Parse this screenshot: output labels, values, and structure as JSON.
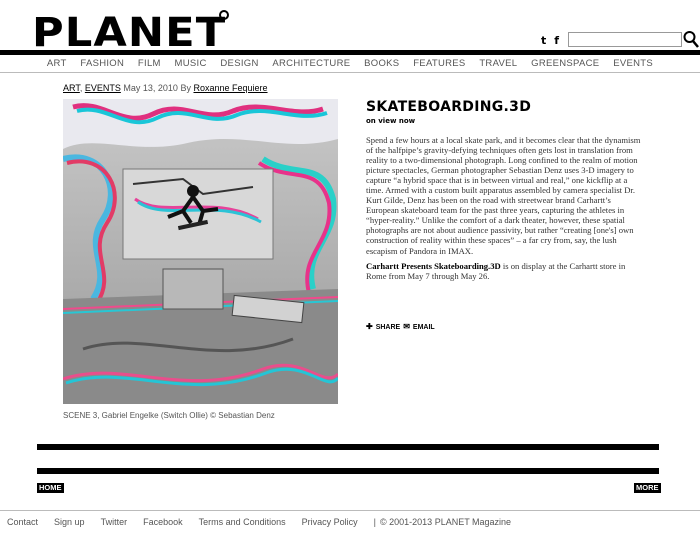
{
  "header": {
    "logo": "PLANET",
    "social": [
      "t",
      "f"
    ],
    "search": {
      "value": "",
      "placeholder": ""
    }
  },
  "nav": [
    "ART",
    "FASHION",
    "FILM",
    "MUSIC",
    "DESIGN",
    "ARCHITECTURE",
    "BOOKS",
    "FEATURES",
    "TRAVEL",
    "GREENSPACE",
    "EVENTS"
  ],
  "article": {
    "categories": [
      "ART",
      "EVENTS"
    ],
    "date": "May 13, 2010",
    "by": "By",
    "author": "Roxanne Fequiere",
    "title": "SKATEBOARDING.3D",
    "subtitle": "on view now",
    "caption": "SCENE 3, Gabriel Engelke (Switch Ollie) © Sebastian Denz",
    "paragraph1": "Spend a few hours at a local skate park, and it becomes clear that the dynamism of the halfpipe’s gravity-defying techniques often gets lost in translation from reality to a two-dimensional photograph. Long confined to the realm of motion picture spectacles, German photographer Sebastian Denz uses 3-D imagery to capture “a hybrid space that is in between virtual and real,” one kickflip at a time. Armed with a custom built apparatus assembled by camera specialist Dr. Kurt Gilde, Denz has been on the road with streetwear brand Carhartt’s European skateboard team for the past three years, capturing the athletes in “hyper-reality.” Unlike the comfort of a dark theater, however, these spatial photographs are not about audience passivity, but rather “creating [one's] own construction of reality within these spaces” – a far cry from, say, the lush escapism of Pandora in IMAX.",
    "paragraph2_bold": "Carhartt Presents Skateboarding.3D",
    "paragraph2_rest": " is on display at the Carhartt store in Rome from May 7 through May 26.",
    "share_label": "SHARE",
    "email_label": "EMAIL"
  },
  "pager": {
    "home": "HOME",
    "more": "MORE"
  },
  "footer": {
    "links": [
      "Contact",
      "Sign up",
      "Twitter",
      "Facebook",
      "Terms and Conditions",
      "Privacy Policy"
    ],
    "separator": "|",
    "copyright": "© 2001-2013 PLANET Magazine"
  }
}
